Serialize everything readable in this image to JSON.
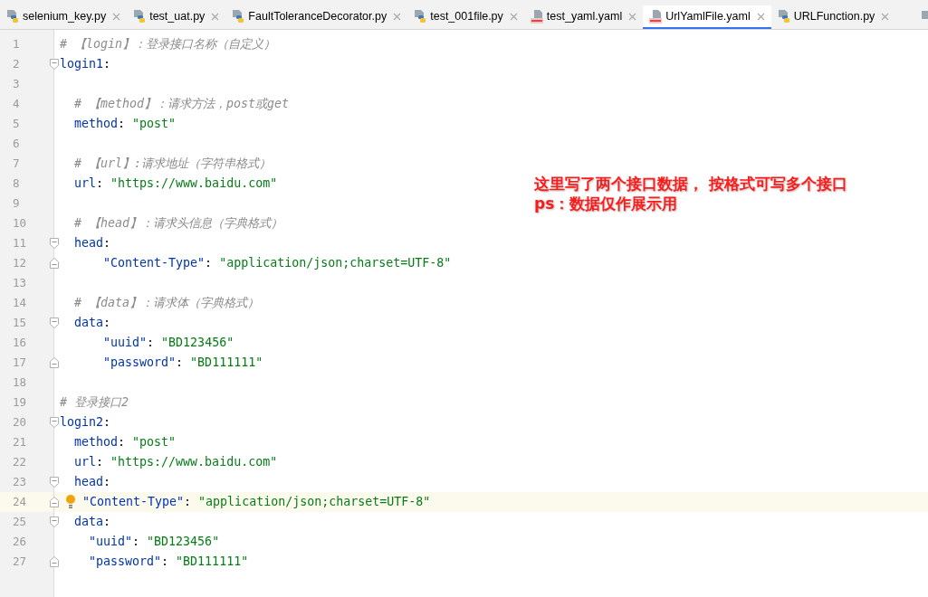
{
  "tabs": [
    {
      "label": "selenium_key.py",
      "kind": "python",
      "selected": false
    },
    {
      "label": "test_uat.py",
      "kind": "python",
      "selected": false
    },
    {
      "label": "FaultToleranceDecorator.py",
      "kind": "python",
      "selected": false
    },
    {
      "label": "test_001file.py",
      "kind": "python",
      "selected": false
    },
    {
      "label": "test_yaml.yaml",
      "kind": "yaml",
      "selected": false
    },
    {
      "label": "UrlYamlFile.yaml",
      "kind": "yaml",
      "selected": true
    },
    {
      "label": "URLFunction.py",
      "kind": "python",
      "selected": false
    }
  ],
  "editor": {
    "lines": [
      {
        "number": "1",
        "fold_start": false,
        "fold_end": false,
        "current": false,
        "tokens": [
          {
            "kind": "comment",
            "text": "# 【login】：登录接口名称（自定义）"
          }
        ]
      },
      {
        "number": "2",
        "fold_start": true,
        "fold_end": false,
        "current": false,
        "tokens": [
          {
            "kind": "key",
            "text": "login1"
          },
          {
            "kind": "punct",
            "text": ":"
          }
        ]
      },
      {
        "number": "3",
        "fold_start": false,
        "fold_end": false,
        "current": false
      },
      {
        "number": "4",
        "fold_start": false,
        "fold_end": false,
        "current": false,
        "tokens": [
          {
            "kind": "comment",
            "text": "  # 【method】：请求方法，post或get"
          }
        ]
      },
      {
        "number": "5",
        "fold_start": false,
        "fold_end": false,
        "current": false,
        "tokens": [
          {
            "kind": "key",
            "text": "  method"
          },
          {
            "kind": "punct",
            "text": ": "
          },
          {
            "kind": "string",
            "text": "\"post\""
          }
        ]
      },
      {
        "number": "6",
        "fold_start": false,
        "fold_end": false,
        "current": false
      },
      {
        "number": "7",
        "fold_start": false,
        "fold_end": false,
        "current": false,
        "tokens": [
          {
            "kind": "comment",
            "text": "  # 【url】:请求地址（字符串格式）"
          }
        ]
      },
      {
        "number": "8",
        "fold_start": false,
        "fold_end": false,
        "current": false,
        "tokens": [
          {
            "kind": "key",
            "text": "  url"
          },
          {
            "kind": "punct",
            "text": ": "
          },
          {
            "kind": "string",
            "text": "\"https://www.baidu.com\""
          }
        ]
      },
      {
        "number": "9",
        "fold_start": false,
        "fold_end": false,
        "current": false
      },
      {
        "number": "10",
        "fold_start": false,
        "fold_end": false,
        "current": false,
        "tokens": [
          {
            "kind": "comment",
            "text": "  # 【head】：请求头信息（字典格式）"
          }
        ]
      },
      {
        "number": "11",
        "fold_start": true,
        "fold_end": false,
        "current": false,
        "tokens": [
          {
            "kind": "key",
            "text": "  head"
          },
          {
            "kind": "punct",
            "text": ":"
          }
        ]
      },
      {
        "number": "12",
        "fold_start": false,
        "fold_end": true,
        "current": false,
        "tokens": [
          {
            "kind": "key",
            "text": "      \"Content-Type\""
          },
          {
            "kind": "punct",
            "text": ": "
          },
          {
            "kind": "string",
            "text": "\"application/json;charset=UTF-8\""
          }
        ]
      },
      {
        "number": "13",
        "fold_start": false,
        "fold_end": false,
        "current": false
      },
      {
        "number": "14",
        "fold_start": false,
        "fold_end": false,
        "current": false,
        "tokens": [
          {
            "kind": "comment",
            "text": "  # 【data】：请求体（字典格式）"
          }
        ]
      },
      {
        "number": "15",
        "fold_start": true,
        "fold_end": false,
        "current": false,
        "tokens": [
          {
            "kind": "key",
            "text": "  data"
          },
          {
            "kind": "punct",
            "text": ":"
          }
        ]
      },
      {
        "number": "16",
        "fold_start": false,
        "fold_end": false,
        "current": false,
        "tokens": [
          {
            "kind": "key",
            "text": "      \"uuid\""
          },
          {
            "kind": "punct",
            "text": ": "
          },
          {
            "kind": "string",
            "text": "\"BD123456\""
          }
        ]
      },
      {
        "number": "17",
        "fold_start": false,
        "fold_end": true,
        "current": false,
        "tokens": [
          {
            "kind": "key",
            "text": "      \"password\""
          },
          {
            "kind": "punct",
            "text": ": "
          },
          {
            "kind": "string",
            "text": "\"BD111111\""
          }
        ]
      },
      {
        "number": "18",
        "fold_start": false,
        "fold_end": false,
        "current": false
      },
      {
        "number": "19",
        "fold_start": false,
        "fold_end": false,
        "current": false,
        "tokens": [
          {
            "kind": "comment",
            "text": "# 登录接口2"
          }
        ]
      },
      {
        "number": "20",
        "fold_start": true,
        "fold_end": false,
        "current": false,
        "tokens": [
          {
            "kind": "key",
            "text": "login2"
          },
          {
            "kind": "punct",
            "text": ":"
          }
        ]
      },
      {
        "number": "21",
        "fold_start": false,
        "fold_end": false,
        "current": false,
        "tokens": [
          {
            "kind": "key",
            "text": "  method"
          },
          {
            "kind": "punct",
            "text": ": "
          },
          {
            "kind": "string",
            "text": "\"post\""
          }
        ]
      },
      {
        "number": "22",
        "fold_start": false,
        "fold_end": false,
        "current": false,
        "tokens": [
          {
            "kind": "key",
            "text": "  url"
          },
          {
            "kind": "punct",
            "text": ": "
          },
          {
            "kind": "string",
            "text": "\"https://www.baidu.com\""
          }
        ]
      },
      {
        "number": "23",
        "fold_start": true,
        "fold_end": false,
        "current": false,
        "tokens": [
          {
            "kind": "key",
            "text": "  head"
          },
          {
            "kind": "punct",
            "text": ":"
          }
        ]
      },
      {
        "number": "24",
        "fold_start": false,
        "fold_end": true,
        "current": true,
        "tokens": [
          {
            "kind": "key",
            "text": "\"Content-Type\""
          },
          {
            "kind": "punct",
            "text": ": "
          },
          {
            "kind": "string",
            "text": "\"application/json;charset=UTF-8\""
          }
        ]
      },
      {
        "number": "25",
        "fold_start": true,
        "fold_end": false,
        "current": false,
        "tokens": [
          {
            "kind": "key",
            "text": "  data"
          },
          {
            "kind": "punct",
            "text": ":"
          }
        ]
      },
      {
        "number": "26",
        "fold_start": false,
        "fold_end": false,
        "current": false,
        "tokens": [
          {
            "kind": "key",
            "text": "    \"uuid\""
          },
          {
            "kind": "punct",
            "text": ": "
          },
          {
            "kind": "string",
            "text": "\"BD123456\""
          }
        ]
      },
      {
        "number": "27",
        "fold_start": false,
        "fold_end": true,
        "current": false,
        "tokens": [
          {
            "kind": "key",
            "text": "    \"password\""
          },
          {
            "kind": "punct",
            "text": ": "
          },
          {
            "kind": "string",
            "text": "\"BD111111\""
          }
        ]
      }
    ]
  },
  "annotation": [
    "这里写了两个接口数据， 按格式可写多个接口",
    "ps：数据仅作展示用"
  ]
}
